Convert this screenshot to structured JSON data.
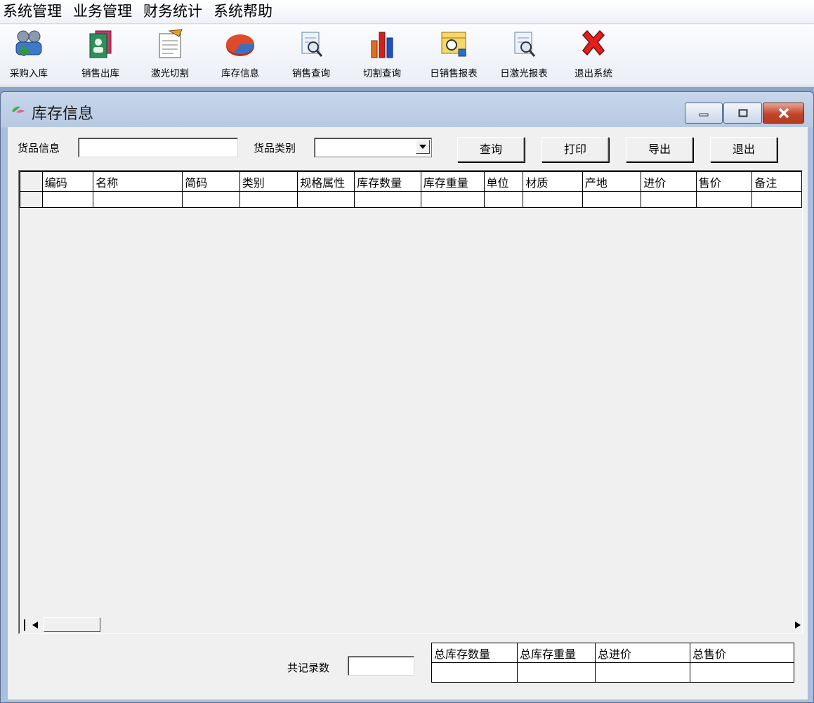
{
  "menu": [
    "系统管理",
    "业务管理",
    "财务统计",
    "系统帮助"
  ],
  "toolbar": [
    {
      "label": "采购入库",
      "icon": "users-add-icon"
    },
    {
      "label": "销售出库",
      "icon": "address-book-icon"
    },
    {
      "label": "激光切割",
      "icon": "document-edit-icon"
    },
    {
      "label": "库存信息",
      "icon": "pie-chart-icon"
    },
    {
      "label": "销售查询",
      "icon": "document-search-icon"
    },
    {
      "label": "切割查询",
      "icon": "bar-chart-icon"
    },
    {
      "label": "日销售报表",
      "icon": "report-search-icon"
    },
    {
      "label": "日激光报表",
      "icon": "document-search-icon"
    },
    {
      "label": "退出系统",
      "icon": "red-x-icon"
    }
  ],
  "window": {
    "title": "库存信息",
    "controls": {
      "minimize": "minimize",
      "maximize": "maximize",
      "close": "close"
    }
  },
  "search": {
    "goods_info_label": "货品信息",
    "goods_info_value": "",
    "category_label": "货品类别",
    "category_value": ""
  },
  "buttons": {
    "query": "查询",
    "print": "打印",
    "export": "导出",
    "exit": "退出"
  },
  "grid": {
    "columns": [
      "编码",
      "名称",
      "简码",
      "类别",
      "规格属性",
      "库存数量",
      "库存重量",
      "单位",
      "材质",
      "产地",
      "进价",
      "售价",
      "备注"
    ],
    "rows": [
      [
        "",
        "",
        "",
        "",
        "",
        "",
        "",
        "",
        "",
        "",
        "",
        "",
        ""
      ]
    ]
  },
  "footer": {
    "record_count_label": "共记录数",
    "record_count_value": "",
    "totals_headers": [
      "总库存数量",
      "总库存重量",
      "总进价",
      "总售价"
    ],
    "totals_values": [
      "",
      "",
      "",
      ""
    ]
  },
  "colors": {
    "close_button": "#c2452a",
    "mdi_background": "#7892b8"
  }
}
